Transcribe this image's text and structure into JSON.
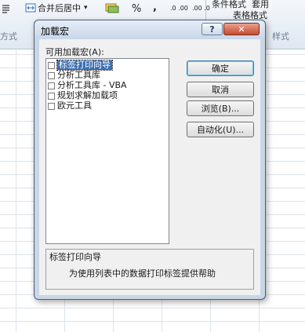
{
  "excel": {
    "ribbon": {
      "wrap_icon_text": "",
      "merge_center_label": "合并后居中",
      "merge_arrow": "▾",
      "currency_icon_text": "",
      "percent_label": "%",
      "comma_label": ",",
      "inc_decimal_label": ".0 .00",
      "dec_decimal_label": ".00 .0",
      "conditional_format_label": "条件格式",
      "table_format_label": "表格格式",
      "apply_label": "套用",
      "group_alignment_label": "方式",
      "group_styles_label": "样式"
    }
  },
  "dialog": {
    "title": "加载宏",
    "help_label": "?",
    "close_label": "✕",
    "list_label": "可用加载宏(A):",
    "addins": [
      {
        "label": "标签打印向导",
        "checked": false,
        "selected": true
      },
      {
        "label": "分析工具库",
        "checked": false,
        "selected": false
      },
      {
        "label": "分析工具库 - VBA",
        "checked": false,
        "selected": false
      },
      {
        "label": "规划求解加载项",
        "checked": false,
        "selected": false
      },
      {
        "label": "欧元工具",
        "checked": false,
        "selected": false
      }
    ],
    "buttons": {
      "ok": "确定",
      "cancel": "取消",
      "browse": "浏览(B)...",
      "automation": "自动化(U)..."
    },
    "description": {
      "title": "标签打印向导",
      "text": "为使用列表中的数据打印标签提供帮助"
    }
  }
}
